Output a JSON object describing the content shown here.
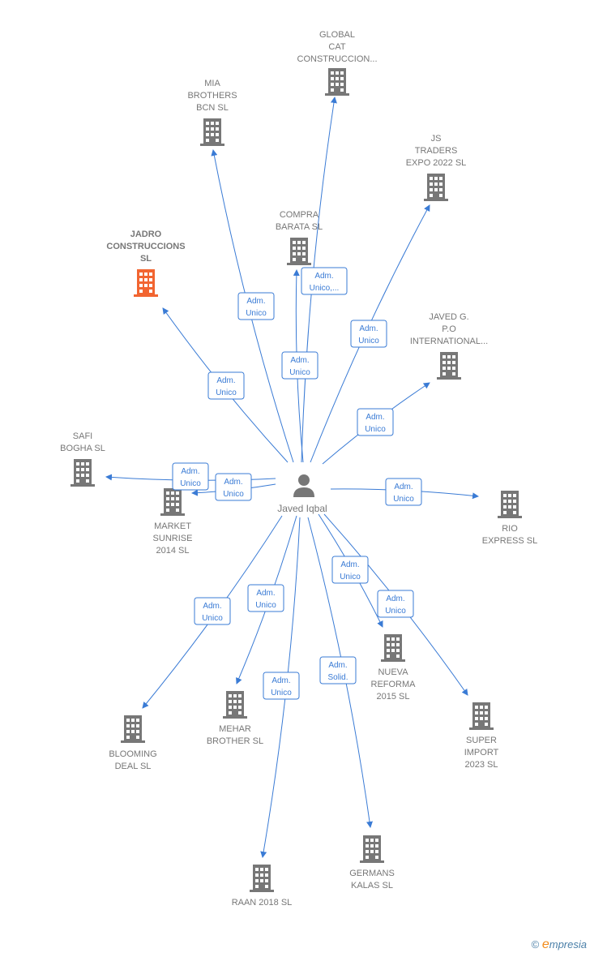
{
  "center": {
    "name": "Javed Iqbal",
    "icon": "person-icon"
  },
  "colors": {
    "edge": "#3a7bd5",
    "building": "#777777",
    "highlight": "#f26531"
  },
  "companies": [
    {
      "lines": [
        "GLOBAL",
        "CAT",
        "CONSTRUCCION..."
      ],
      "role": [
        "Adm.",
        "Unico,..."
      ],
      "highlight": false
    },
    {
      "lines": [
        "MIA",
        "BROTHERS",
        "BCN  SL"
      ],
      "role": [
        "Adm.",
        "Unico"
      ],
      "highlight": false
    },
    {
      "lines": [
        "JS",
        "TRADERS",
        "EXPO 2022  SL"
      ],
      "role": [
        "Adm.",
        "Unico"
      ],
      "highlight": false
    },
    {
      "lines": [
        "COMPRA",
        "BARATA SL"
      ],
      "role": [
        "Adm.",
        "Unico"
      ],
      "highlight": false
    },
    {
      "lines": [
        "JADRO",
        "CONSTRUCCIONS",
        "SL"
      ],
      "role": [
        "Adm.",
        "Unico"
      ],
      "highlight": true
    },
    {
      "lines": [
        "JAVED G.",
        "P.O",
        "INTERNATIONAL..."
      ],
      "role": [
        "Adm.",
        "Unico"
      ],
      "highlight": false
    },
    {
      "lines": [
        "SAFI",
        "BOGHA  SL"
      ],
      "role": [
        "Adm.",
        "Unico"
      ],
      "highlight": false
    },
    {
      "lines": [
        "MARKET",
        "SUNRISE",
        "2014  SL"
      ],
      "role": [
        "Adm.",
        "Unico"
      ],
      "highlight": false
    },
    {
      "lines": [
        "RIO",
        "EXPRESS  SL"
      ],
      "role": [
        "Adm.",
        "Unico"
      ],
      "highlight": false
    },
    {
      "lines": [
        "NUEVA",
        "REFORMA",
        "2015  SL"
      ],
      "role": [
        "Adm.",
        "Unico"
      ],
      "highlight": false
    },
    {
      "lines": [
        "SUPER",
        "IMPORT",
        "2023  SL"
      ],
      "role": [
        "Adm.",
        "Unico"
      ],
      "highlight": false
    },
    {
      "lines": [
        "MEHAR",
        "BROTHER  SL"
      ],
      "role": [
        "Adm.",
        "Unico"
      ],
      "highlight": false
    },
    {
      "lines": [
        "BLOOMING",
        "DEAL  SL"
      ],
      "role": [
        "Adm.",
        "Unico"
      ],
      "highlight": false
    },
    {
      "lines": [
        "RAAN 2018  SL"
      ],
      "role": [
        "Adm.",
        "Unico"
      ],
      "highlight": false
    },
    {
      "lines": [
        "GERMANS",
        "KALAS SL"
      ],
      "role": [
        "Adm.",
        "Solid."
      ],
      "highlight": false
    }
  ],
  "footer": {
    "copyright": "©",
    "brand_initial": "e",
    "brand_rest": "mpresia"
  }
}
